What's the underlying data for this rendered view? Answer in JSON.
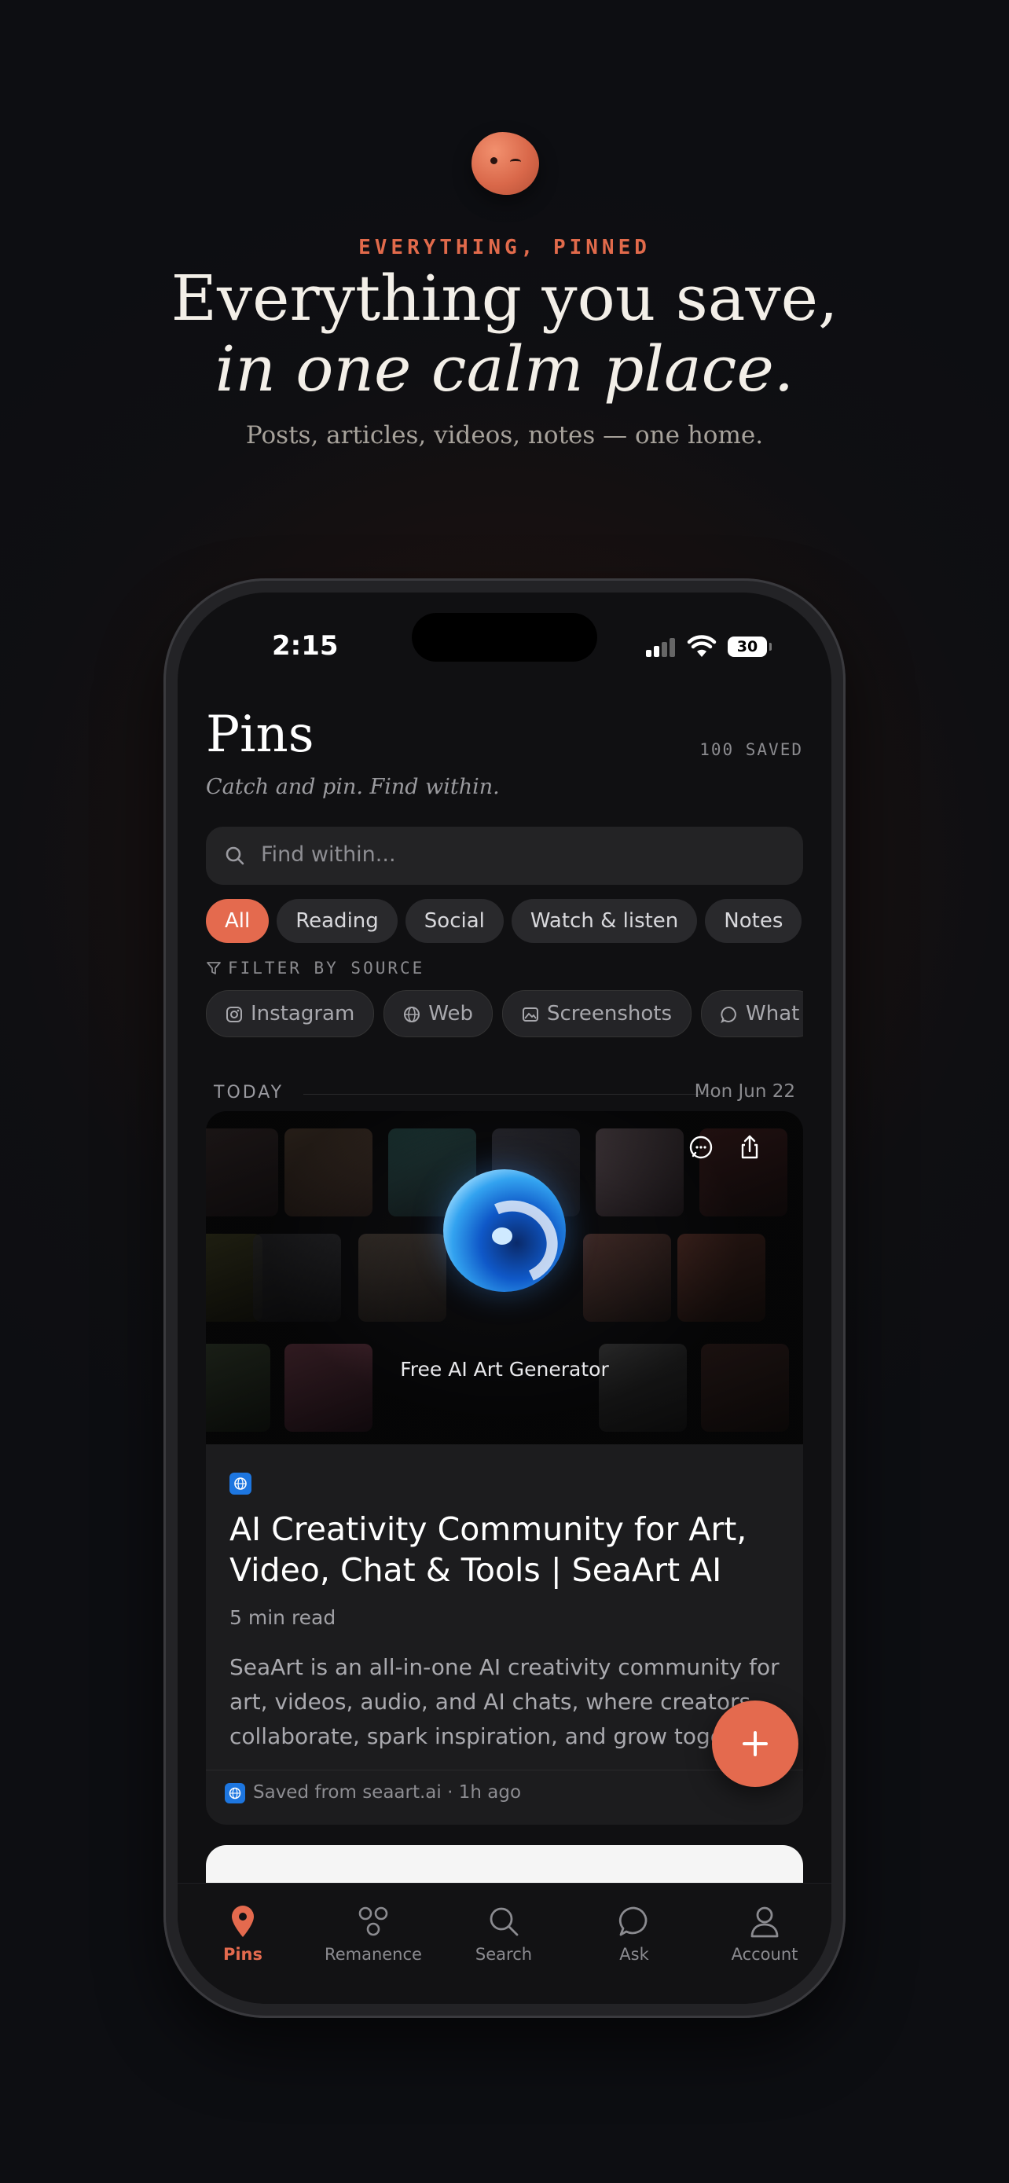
{
  "brand": {
    "accent": "#e46a4e",
    "background": "#101012"
  },
  "hero": {
    "kicker": "EVERYTHING, PINNED",
    "headline_line1": "Everything you save,",
    "headline_line2": "in one calm place.",
    "subhead": "Posts, articles, videos, notes — one home."
  },
  "status_bar": {
    "time": "2:15",
    "battery": "30"
  },
  "app": {
    "title": "Pins",
    "saved_count": "100 SAVED",
    "tagline": "Catch and pin. Find within.",
    "search_placeholder": "Find within..."
  },
  "categories": [
    {
      "label": "All",
      "active": true
    },
    {
      "label": "Reading",
      "active": false
    },
    {
      "label": "Social",
      "active": false
    },
    {
      "label": "Watch & listen",
      "active": false
    },
    {
      "label": "Notes",
      "active": false
    }
  ],
  "filter": {
    "label": "FILTER BY SOURCE",
    "sources": [
      {
        "label": "Instagram",
        "icon": "instagram-icon"
      },
      {
        "label": "Web",
        "icon": "globe-icon"
      },
      {
        "label": "Screenshots",
        "icon": "image-icon"
      },
      {
        "label": "What",
        "icon": "whatsapp-icon"
      }
    ]
  },
  "section": {
    "label": "TODAY",
    "date": "Mon Jun 22"
  },
  "card": {
    "hero_caption": "Free AI Art Generator",
    "title": "AI Creativity Community for Art, Video, Chat & Tools | SeaArt AI",
    "read_time": "5 min read",
    "description": "SeaArt is an all-in-one AI creativity community for art, videos, audio, and AI chats, where creators collaborate, spark inspiration, and grow together.",
    "saved_from": "Saved from seaart.ai",
    "saved_ago": "1h ago"
  },
  "tabs": [
    {
      "label": "Pins",
      "icon": "pin-icon",
      "active": true
    },
    {
      "label": "Remanence",
      "icon": "nodes-icon",
      "active": false
    },
    {
      "label": "Search",
      "icon": "search-icon",
      "active": false
    },
    {
      "label": "Ask",
      "icon": "chat-icon",
      "active": false
    },
    {
      "label": "Account",
      "icon": "person-icon",
      "active": false
    }
  ]
}
